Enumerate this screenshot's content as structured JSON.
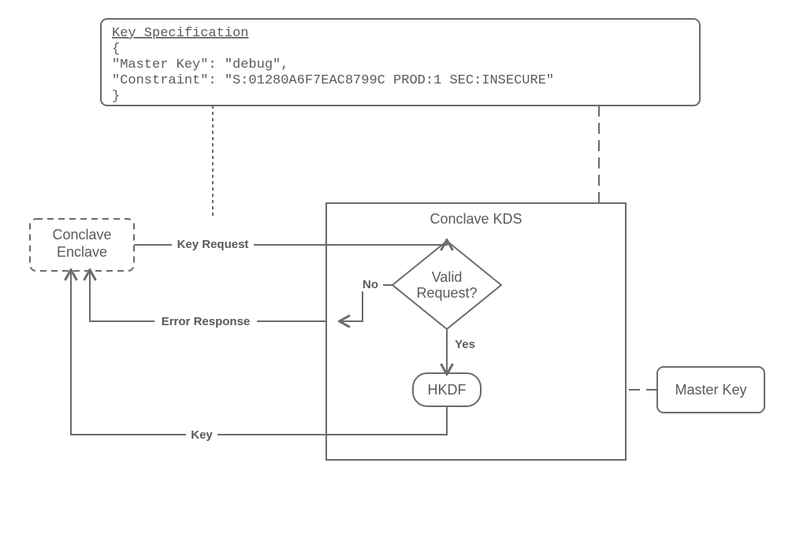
{
  "spec": {
    "title": "Key Specification",
    "line1": "{",
    "line2": "   \"Master Key\": \"debug\",",
    "line3": "   \"Constraint\": \"S:01280A6F7EAC8799C PROD:1 SEC:INSECURE\"",
    "line4": "}"
  },
  "nodes": {
    "enclave": "Conclave",
    "enclave2": "Enclave",
    "kds": "Conclave KDS",
    "valid1": "Valid",
    "valid2": "Request?",
    "hkdf": "HKDF",
    "masterKey": "Master Key"
  },
  "edges": {
    "keyRequest": "Key Request",
    "errorResponse": "Error Response",
    "no": "No",
    "yes": "Yes",
    "key": "Key"
  }
}
